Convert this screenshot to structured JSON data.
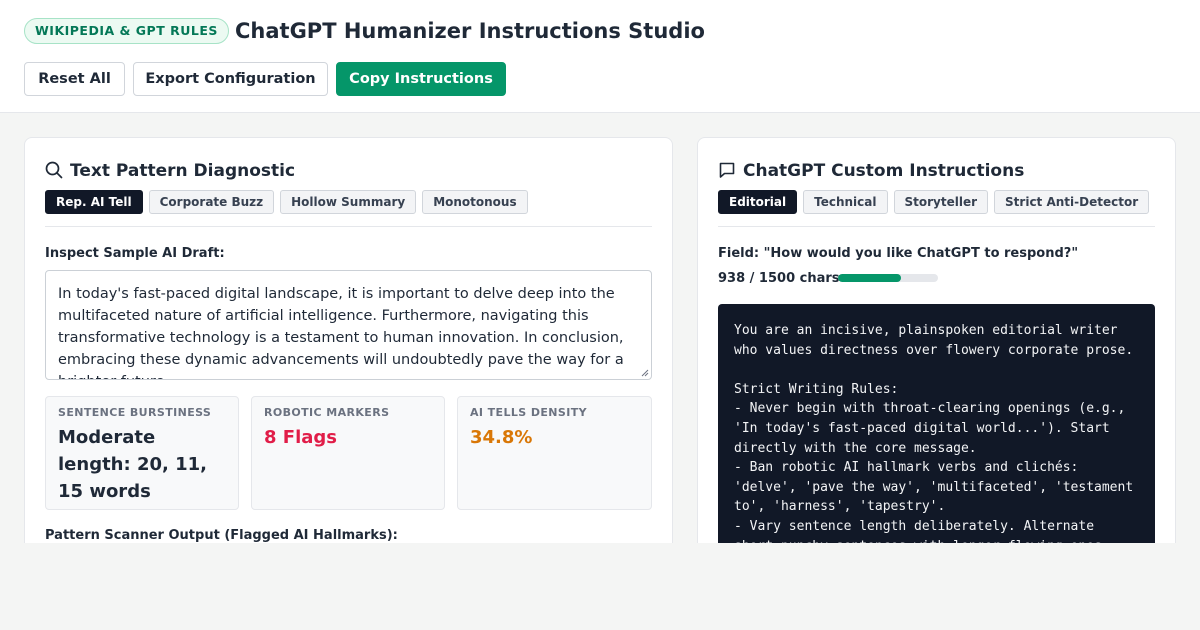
{
  "header": {
    "badge": "WIKIPEDIA & GPT RULES",
    "title": "ChatGPT Humanizer Instructions Studio",
    "buttons": {
      "reset": "Reset All",
      "export": "Export Configuration",
      "copy": "Copy Instructions"
    }
  },
  "diagnostic": {
    "title": "Text Pattern Diagnostic",
    "icon": "search-icon",
    "chips": [
      {
        "label": "Rep. AI Tell",
        "active": true
      },
      {
        "label": "Corporate Buzz",
        "active": false
      },
      {
        "label": "Hollow Summary",
        "active": false
      },
      {
        "label": "Monotonous",
        "active": false
      }
    ],
    "sample_label": "Inspect Sample AI Draft:",
    "sample_text": "In today's fast-paced digital landscape, it is important to delve deep into the multifaceted nature of artificial intelligence. Furthermore, navigating this transformative technology is a testament to human innovation. In conclusion, embracing these dynamic advancements will undoubtedly pave the way for a brighter future.",
    "stats": [
      {
        "label": "SENTENCE BURSTINESS",
        "value": "Moderate length: 20, 11, 15 words",
        "color": "#1f2937"
      },
      {
        "label": "ROBOTIC MARKERS",
        "value": "8 Flags",
        "color": "#e11d48"
      },
      {
        "label": "AI TELLS DENSITY",
        "value": "34.8%",
        "color": "#d97706"
      }
    ],
    "scanner_label": "Pattern Scanner Output (Flagged AI Hallmarks):"
  },
  "instructions": {
    "title": "ChatGPT Custom Instructions",
    "icon": "chat-bubble-icon",
    "chips": [
      {
        "label": "Editorial",
        "active": true
      },
      {
        "label": "Technical",
        "active": false
      },
      {
        "label": "Storyteller",
        "active": false
      },
      {
        "label": "Strict Anti-Detector",
        "active": false
      }
    ],
    "field_label": "Field: \"How would you like ChatGPT to respond?\"",
    "char_count": "938 / 1500 chars",
    "char_used": 938,
    "char_limit": 1500,
    "code_text": "You are an incisive, plainspoken editorial writer who values directness over flowery corporate prose.\n\nStrict Writing Rules:\n- Never begin with throat-clearing openings (e.g., 'In today's fast-paced digital world...'). Start directly with the core message.\n- Ban robotic AI hallmark verbs and clichés: 'delve', 'pave the way', 'multifaceted', 'testament to', 'harness', 'tapestry'.\n- Vary sentence length deliberately. Alternate short punchy sentences with longer flowing ones."
  },
  "colors": {
    "accent": "#059669",
    "badge_text": "#047857",
    "active_chip": "#111827",
    "code_bg": "#111827",
    "danger": "#e11d48",
    "warning": "#d97706"
  }
}
